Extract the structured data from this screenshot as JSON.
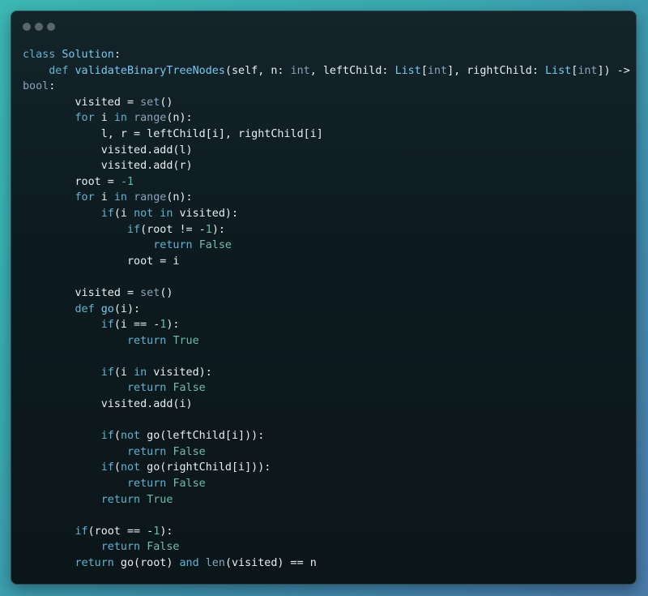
{
  "window": {
    "controls": [
      "dot",
      "dot",
      "dot"
    ]
  },
  "code": {
    "language": "python",
    "lines": [
      [
        [
          "kw",
          "class"
        ],
        [
          "t",
          " "
        ],
        [
          "fn",
          "Solution"
        ],
        [
          "t",
          ":"
        ]
      ],
      [
        [
          "t",
          "    "
        ],
        [
          "kw",
          "def"
        ],
        [
          "t",
          " "
        ],
        [
          "fn",
          "validateBinaryTreeNodes"
        ],
        [
          "t",
          "(self, n: "
        ],
        [
          "bi",
          "int"
        ],
        [
          "t",
          ", leftChild: "
        ],
        [
          "ty",
          "List"
        ],
        [
          "t",
          "["
        ],
        [
          "bi",
          "int"
        ],
        [
          "t",
          "], rightChild: "
        ],
        [
          "ty",
          "List"
        ],
        [
          "t",
          "["
        ],
        [
          "bi",
          "int"
        ],
        [
          "t",
          "]) ->"
        ]
      ],
      [
        [
          "bi",
          "bool"
        ],
        [
          "t",
          ":"
        ]
      ],
      [
        [
          "t",
          "        visited = "
        ],
        [
          "bi",
          "set"
        ],
        [
          "t",
          "()"
        ]
      ],
      [
        [
          "t",
          "        "
        ],
        [
          "kw",
          "for"
        ],
        [
          "t",
          " i "
        ],
        [
          "kw",
          "in"
        ],
        [
          "t",
          " "
        ],
        [
          "bi",
          "range"
        ],
        [
          "t",
          "(n):"
        ]
      ],
      [
        [
          "t",
          "            l, r = leftChild[i], rightChild[i]"
        ]
      ],
      [
        [
          "t",
          "            visited.add(l)"
        ]
      ],
      [
        [
          "t",
          "            visited.add(r)"
        ]
      ],
      [
        [
          "t",
          "        root = "
        ],
        [
          "num",
          "-1"
        ]
      ],
      [
        [
          "t",
          "        "
        ],
        [
          "kw",
          "for"
        ],
        [
          "t",
          " i "
        ],
        [
          "kw",
          "in"
        ],
        [
          "t",
          " "
        ],
        [
          "bi",
          "range"
        ],
        [
          "t",
          "(n):"
        ]
      ],
      [
        [
          "t",
          "            "
        ],
        [
          "kw",
          "if"
        ],
        [
          "t",
          "(i "
        ],
        [
          "kw",
          "not in"
        ],
        [
          "t",
          " visited):"
        ]
      ],
      [
        [
          "t",
          "                "
        ],
        [
          "kw",
          "if"
        ],
        [
          "t",
          "(root != -"
        ],
        [
          "num",
          "1"
        ],
        [
          "t",
          "):"
        ]
      ],
      [
        [
          "t",
          "                    "
        ],
        [
          "kw",
          "return"
        ],
        [
          "t",
          " "
        ],
        [
          "lit",
          "False"
        ]
      ],
      [
        [
          "t",
          "                root = i"
        ]
      ],
      [
        [
          "t",
          ""
        ]
      ],
      [
        [
          "t",
          "        visited = "
        ],
        [
          "bi",
          "set"
        ],
        [
          "t",
          "()"
        ]
      ],
      [
        [
          "t",
          "        "
        ],
        [
          "kw",
          "def"
        ],
        [
          "t",
          " "
        ],
        [
          "fn",
          "go"
        ],
        [
          "t",
          "(i):"
        ]
      ],
      [
        [
          "t",
          "            "
        ],
        [
          "kw",
          "if"
        ],
        [
          "t",
          "(i == -"
        ],
        [
          "num",
          "1"
        ],
        [
          "t",
          "):"
        ]
      ],
      [
        [
          "t",
          "                "
        ],
        [
          "kw",
          "return"
        ],
        [
          "t",
          " "
        ],
        [
          "lit",
          "True"
        ]
      ],
      [
        [
          "t",
          ""
        ]
      ],
      [
        [
          "t",
          "            "
        ],
        [
          "kw",
          "if"
        ],
        [
          "t",
          "(i "
        ],
        [
          "kw",
          "in"
        ],
        [
          "t",
          " visited):"
        ]
      ],
      [
        [
          "t",
          "                "
        ],
        [
          "kw",
          "return"
        ],
        [
          "t",
          " "
        ],
        [
          "lit",
          "False"
        ]
      ],
      [
        [
          "t",
          "            visited.add(i)"
        ]
      ],
      [
        [
          "t",
          ""
        ]
      ],
      [
        [
          "t",
          "            "
        ],
        [
          "kw",
          "if"
        ],
        [
          "t",
          "("
        ],
        [
          "kw",
          "not"
        ],
        [
          "t",
          " go(leftChild[i])):"
        ]
      ],
      [
        [
          "t",
          "                "
        ],
        [
          "kw",
          "return"
        ],
        [
          "t",
          " "
        ],
        [
          "lit",
          "False"
        ]
      ],
      [
        [
          "t",
          "            "
        ],
        [
          "kw",
          "if"
        ],
        [
          "t",
          "("
        ],
        [
          "kw",
          "not"
        ],
        [
          "t",
          " go(rightChild[i])):"
        ]
      ],
      [
        [
          "t",
          "                "
        ],
        [
          "kw",
          "return"
        ],
        [
          "t",
          " "
        ],
        [
          "lit",
          "False"
        ]
      ],
      [
        [
          "t",
          "            "
        ],
        [
          "kw",
          "return"
        ],
        [
          "t",
          " "
        ],
        [
          "lit",
          "True"
        ]
      ],
      [
        [
          "t",
          ""
        ]
      ],
      [
        [
          "t",
          "        "
        ],
        [
          "kw",
          "if"
        ],
        [
          "t",
          "(root == -"
        ],
        [
          "num",
          "1"
        ],
        [
          "t",
          "):"
        ]
      ],
      [
        [
          "t",
          "            "
        ],
        [
          "kw",
          "return"
        ],
        [
          "t",
          " "
        ],
        [
          "lit",
          "False"
        ]
      ],
      [
        [
          "t",
          "        "
        ],
        [
          "kw",
          "return"
        ],
        [
          "t",
          " go(root) "
        ],
        [
          "kw",
          "and"
        ],
        [
          "t",
          " "
        ],
        [
          "bi",
          "len"
        ],
        [
          "t",
          "(visited) == n"
        ]
      ]
    ]
  }
}
